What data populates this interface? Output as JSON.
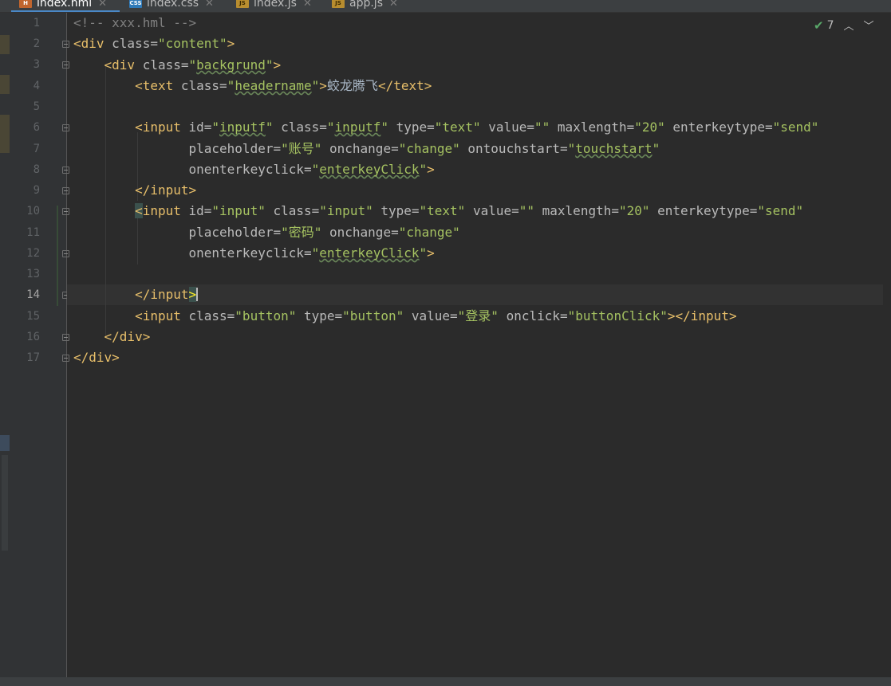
{
  "tabs": [
    {
      "label": "index.hml",
      "icon": "html-file-icon",
      "badge": "H",
      "active": true
    },
    {
      "label": "index.css",
      "icon": "css-file-icon",
      "badge": "CSS",
      "active": false
    },
    {
      "label": "index.js",
      "icon": "js-file-icon",
      "badge": "JS",
      "active": false
    },
    {
      "label": "app.js",
      "icon": "js-file-icon",
      "badge": "JS",
      "active": false
    }
  ],
  "inspections": {
    "count": "7"
  },
  "current_line": "14",
  "line_numbers": [
    "1",
    "2",
    "3",
    "4",
    "5",
    "6",
    "7",
    "8",
    "9",
    "10",
    "11",
    "12",
    "13",
    "14",
    "15",
    "16",
    "17"
  ],
  "code": {
    "l1": {
      "comment": "<!-- xxx.hml -->"
    },
    "l2": {
      "open": "<div",
      "a1": " class=",
      "v1": "\"content\"",
      "close": ">"
    },
    "l3": {
      "open": "<div",
      "a1": " class=",
      "v1q1": "\"",
      "v1": "backgrund",
      "v1q2": "\"",
      "close": ">"
    },
    "l4": {
      "open": "<text",
      "a1": " class=",
      "v1q1": "\"",
      "v1": "headername",
      "v1q2": "\"",
      "gt": ">",
      "text": "蛟龙腾飞",
      "end": "</text",
      "close": ">"
    },
    "l6": {
      "open": "<input",
      "a1": " id=",
      "v1q1": "\"",
      "v1": "inputf",
      "v1q2": "\"",
      "a2": " class=",
      "v2q1": "\"",
      "v2": "inputf",
      "v2q2": "\"",
      "a3": " type=",
      "v3": "\"text\"",
      "a4": " value=",
      "v4": "\"\"",
      "a5": " maxlength=",
      "v5": "\"20\"",
      "a6": " enterkeytype=",
      "v6": "\"send\""
    },
    "l7": {
      "a1": "placeholder=",
      "v1": "\"账号\"",
      "a2": " onchange=",
      "v2": "\"change\"",
      "a3": " ontouchstart=",
      "v3q1": "\"",
      "v3": "touchstart",
      "v3q2": "\""
    },
    "l8": {
      "a1": "onenterkeyclick=",
      "v1q1": "\"",
      "v1": "enterkeyClick",
      "v1q2": "\"",
      "close": ">"
    },
    "l9": {
      "end": "</input",
      "close": ">"
    },
    "l10": {
      "lt": "<",
      "open": "input",
      "a1": " id=",
      "v1": "\"input\"",
      "a2": " class=",
      "v2": "\"input\"",
      "a3": " type=",
      "v3": "\"text\"",
      "a4": " value=",
      "v4": "\"\"",
      "a5": " maxlength=",
      "v5": "\"20\"",
      "a6": " enterkeytype=",
      "v6": "\"send\""
    },
    "l11": {
      "a1": "placeholder=",
      "v1": "\"密码\"",
      "a2": " onchange=",
      "v2": "\"change\""
    },
    "l12": {
      "a1": "onenterkeyclick=",
      "v1q1": "\"",
      "v1": "enterkeyClick",
      "v1q2": "\"",
      "close": ">"
    },
    "l14": {
      "end": "</input",
      "close": ">"
    },
    "l15": {
      "open": "<input",
      "a1": " class=",
      "v1": "\"button\"",
      "a2": " type=",
      "v2": "\"button\"",
      "a3": " value=",
      "v3": "\"登录\"",
      "a4": " onclick=",
      "v4": "\"buttonClick\"",
      "gt": ">",
      "end": "</input",
      "close": ">"
    },
    "l16": {
      "end": "</div",
      "close": ">"
    },
    "l17": {
      "end": "</div",
      "close": ">"
    }
  },
  "colors": {
    "background": "#2b2b2b",
    "gutter": "#313335",
    "tag": "#e8bf6a",
    "attribute": "#bababa",
    "string": "#a5c261",
    "comment": "#808080",
    "text": "#a9b7c6",
    "tab_accent": "#4a88c7",
    "inspection_ok": "#59a869"
  }
}
